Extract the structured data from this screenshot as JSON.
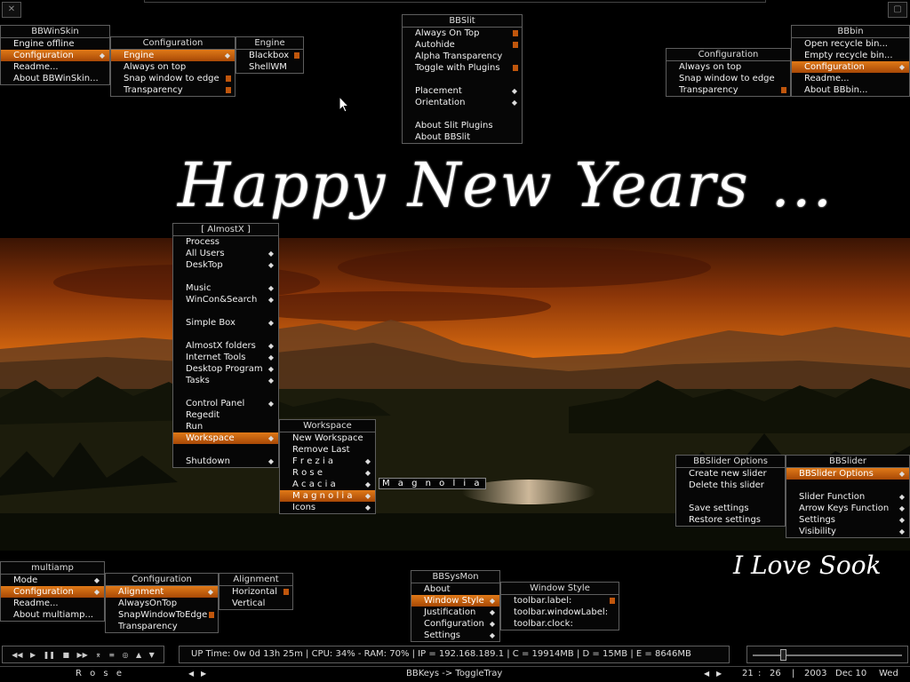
{
  "wallpaper": {
    "title": "Happy New Years ...",
    "caption": "I Love Sook"
  },
  "corner": {
    "left_icon": "x-icon",
    "right_icon": "window-icon"
  },
  "bbwinskin": {
    "title": "BBWinSkin",
    "items": [
      "Engine offline",
      "Configuration",
      "Readme...",
      "About BBWinSkin..."
    ]
  },
  "bbwinskin_config": {
    "title": "Configuration",
    "items": [
      "Engine",
      "Always on top",
      "Snap window to edge",
      "Transparency"
    ]
  },
  "bbwinskin_engine": {
    "title": "Engine",
    "items": [
      "Blackbox",
      "ShellWM"
    ]
  },
  "bbslit": {
    "title": "BBSlit",
    "items": [
      "Always On Top",
      "Autohide",
      "Alpha Transparency",
      "Toggle with Plugins",
      "Placement",
      "Orientation",
      "About Slit Plugins",
      "About BBSlit"
    ]
  },
  "bbbin_config": {
    "title": "Configuration",
    "items": [
      "Always on top",
      "Snap window to edge",
      "Transparency"
    ]
  },
  "bbbin": {
    "title": "BBbin",
    "items": [
      "Open recycle bin...",
      "Empty recycle bin...",
      "Configuration",
      "Readme...",
      "About BBbin..."
    ]
  },
  "almostx": {
    "title": "[ AlmostX ]",
    "items": [
      "Process",
      "All Users",
      "DeskTop",
      "Music",
      "WinCon&Search",
      "Simple Box",
      "AlmostX folders",
      "Internet Tools",
      "Desktop Program",
      "Tasks",
      "Control Panel",
      "Regedit",
      "Run",
      "Workspace",
      "Shutdown"
    ]
  },
  "workspace": {
    "title": "Workspace",
    "items": [
      "New Workspace",
      "Remove Last",
      "F r e z i a",
      "R o s e",
      "A c a c i a",
      "M a g n o l i a",
      "Icons"
    ],
    "tooltip": "M a g n o l i a"
  },
  "bbslider_options": {
    "title": "BBSlider Options",
    "items": [
      "Create new slider",
      "Delete this slider",
      "Save settings",
      "Restore settings"
    ]
  },
  "bbslider": {
    "title": "BBSlider",
    "items": [
      "BBSlider Options",
      "Slider Function",
      "Arrow Keys Function",
      "Settings",
      "Visibility"
    ]
  },
  "multiamp": {
    "title": "multiamp",
    "items": [
      "Mode",
      "Configuration",
      "Readme...",
      "About multiamp..."
    ]
  },
  "multiamp_config": {
    "title": "Configuration",
    "items": [
      "Alignment",
      "AlwaysOnTop",
      "SnapWindowToEdge",
      "Transparency"
    ]
  },
  "multiamp_align": {
    "title": "Alignment",
    "items": [
      "Horizontal",
      "Vertical"
    ]
  },
  "bbsysmon": {
    "title": "BBSysMon",
    "items": [
      "About",
      "Window Style",
      "Justification",
      "Configuration",
      "Settings"
    ]
  },
  "window_style": {
    "title": "Window Style",
    "items": [
      "toolbar.label:",
      "toolbar.windowLabel:",
      "toolbar.clock:"
    ]
  },
  "sysinfo": {
    "text": "UP Time: 0w 0d 13h 25m  |  CPU: 34% - RAM: 70%  |  IP = 192.168.189.1  |  C = 19914MB  |  D = 15MB  |  E = 8646MB"
  },
  "player": {
    "buttons": [
      "prev-icon",
      "play-icon",
      "pause-icon",
      "stop-icon",
      "next-icon",
      "shuffle-icon",
      "playlist-icon",
      "record-icon",
      "volume-up-icon",
      "volume-down-icon"
    ]
  },
  "slider": {
    "level": 0.2
  },
  "toolbar": {
    "workspace": "R o s e",
    "window_label": "BBKeys -> ToggleTray",
    "hour": "21",
    "minute": "26",
    "year": "2003",
    "date": "Dec 10",
    "day": "Wed"
  },
  "colors": {
    "accent": "#d8701a",
    "menu_bg": "#060606",
    "border": "#5e5e5e"
  }
}
